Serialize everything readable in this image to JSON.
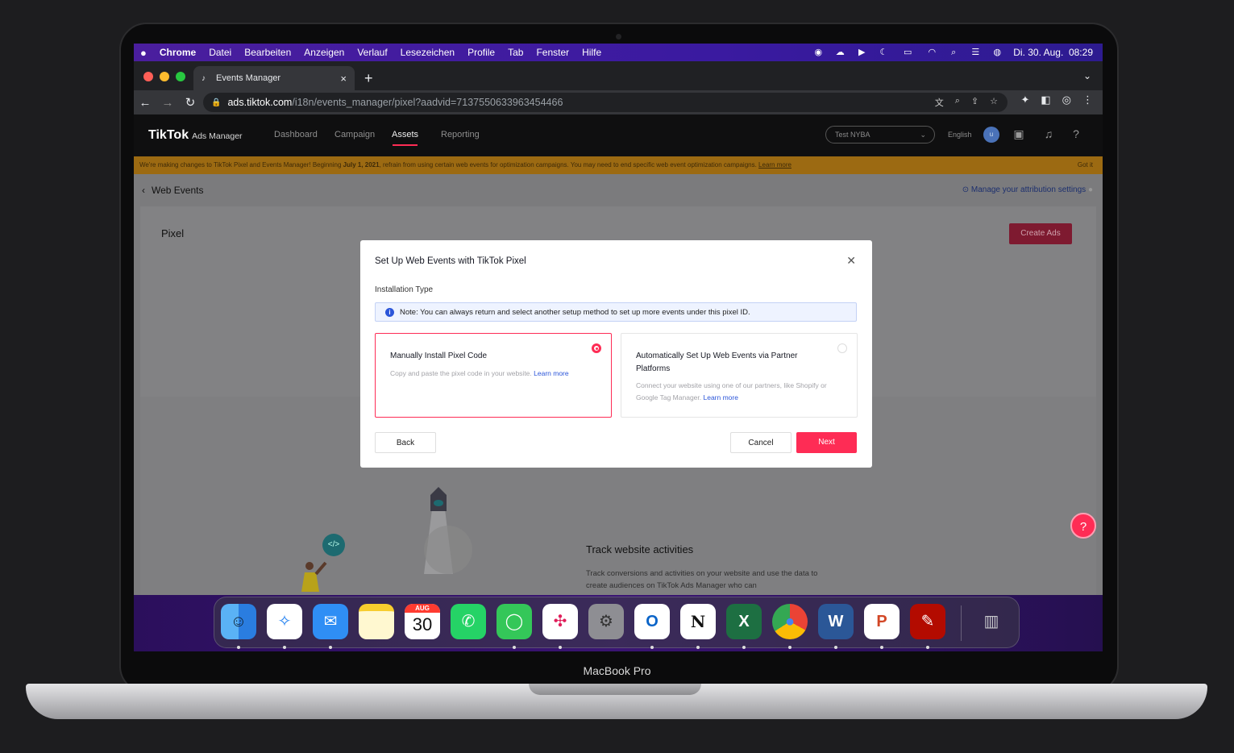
{
  "device": {
    "label": "MacBook Pro"
  },
  "menubar": {
    "apple": "",
    "app": "Chrome",
    "items": [
      "Datei",
      "Bearbeiten",
      "Anzeigen",
      "Verlauf",
      "Lesezeichen",
      "Profile",
      "Tab",
      "Fenster",
      "Hilfe"
    ],
    "clock": "Di. 30. Aug.  08:29"
  },
  "browser": {
    "tab_title": "Events Manager",
    "url_domain": "ads.tiktok.com",
    "url_path": "/i18n/events_manager/pixel?aadvid=7137550633963454466"
  },
  "tiktok": {
    "logo": "TikTok",
    "logo_sub": "Ads Manager",
    "nav": [
      "Dashboard",
      "Campaign",
      "Assets",
      "Reporting"
    ],
    "active_nav": "Assets",
    "account": "Test NYBA",
    "language": "English",
    "avatar": "u"
  },
  "banner": {
    "text_pre": "We're making changes to TikTok Pixel and Events Manager! Beginning ",
    "date": "July 1, 2021",
    "text_post": ", refrain from using certain web events for optimization campaigns. You may need to end specific web event optimization campaigns. ",
    "link": "Learn more",
    "dismiss": "Got it"
  },
  "page": {
    "back_title": "Web Events",
    "attribution_link": "Manage your attribution settings",
    "pixel_title": "Pixel",
    "create_ads": "Create Ads",
    "track_title": "Track website activities",
    "track_desc": "Track conversions and activities on your website and use the data to create audiences on TikTok Ads Manager who can"
  },
  "modal": {
    "title": "Set Up Web Events with TikTok Pixel",
    "section_label": "Installation Type",
    "note": "Note: You can always return and select another setup method to set up more events under this pixel ID.",
    "options": [
      {
        "title": "Manually Install Pixel Code",
        "desc": "Copy and paste the pixel code in your website. ",
        "link": "Learn more",
        "selected": true
      },
      {
        "title": "Automatically Set Up Web Events via Partner Platforms",
        "desc": "Connect your website using one of our partners, like Shopify or Google Tag Manager. ",
        "link": "Learn more",
        "selected": false
      }
    ],
    "back": "Back",
    "cancel": "Cancel",
    "next": "Next"
  },
  "dock": {
    "calendar_month": "AUG",
    "calendar_day": "30",
    "apps": [
      "finder-icon",
      "safari-icon",
      "mail-icon",
      "notes-icon",
      "calendar-icon",
      "whatsapp-icon",
      "messages-icon",
      "slack-icon",
      "system-preferences-icon",
      "outlook-icon",
      "notion-icon",
      "excel-icon",
      "chrome-icon",
      "word-icon",
      "powerpoint-icon",
      "acrobat-icon",
      "trash-icon"
    ]
  },
  "colors": {
    "accent": "#fe2c55",
    "link": "#2b55d9"
  }
}
